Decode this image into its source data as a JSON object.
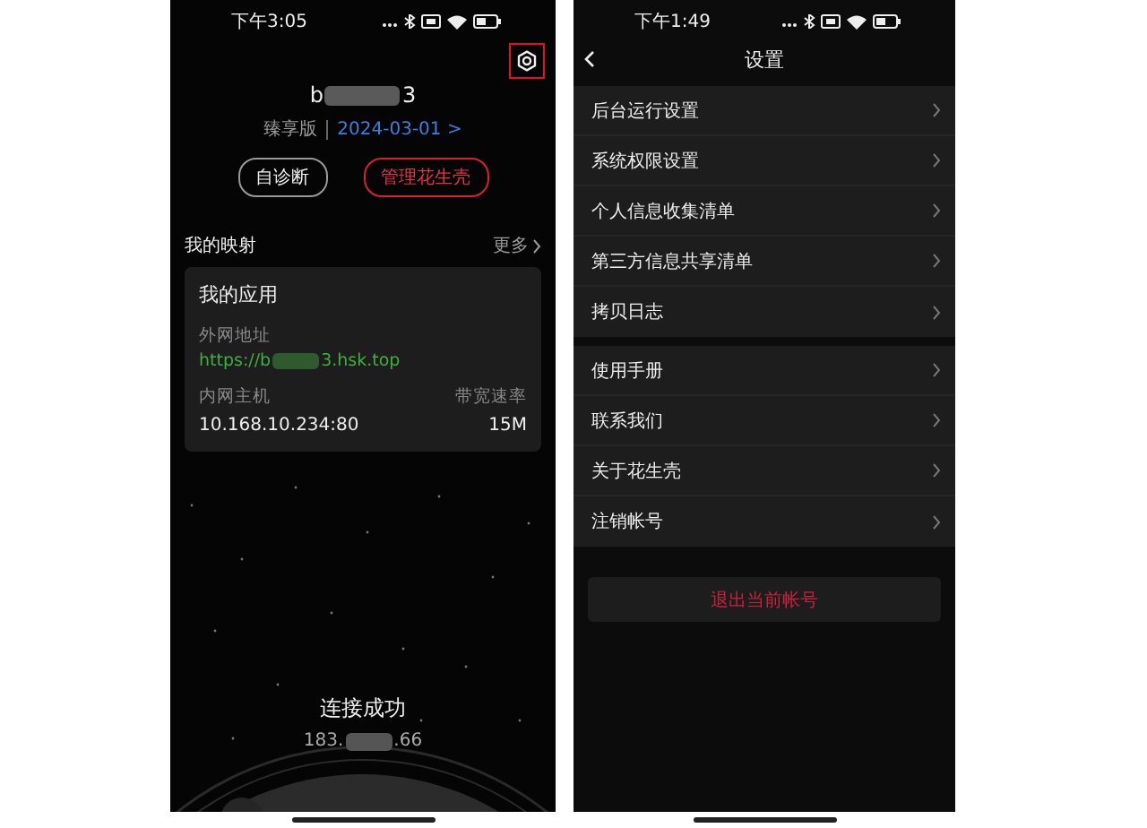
{
  "home_screen": {
    "status_bar": {
      "time": "下午3:05"
    },
    "settings_button": {
      "highlighted": true
    },
    "account": {
      "name_start": "b",
      "name_end": "3",
      "edition": "臻享版",
      "expiry": "2024-03-01 >"
    },
    "actions": [
      {
        "label": "自诊断",
        "kind": "outline"
      },
      {
        "label": "管理花生壳",
        "kind": "accent"
      }
    ],
    "mappings": {
      "title": "我的映射",
      "more": "更多",
      "card": {
        "title": "我的应用",
        "external_label": "外网地址",
        "url_start": "https://b",
        "url_end": "3.hsk.top",
        "host_label": "内网主机",
        "host": "10.168.10.234:80",
        "bandwidth_label": "带宽速率",
        "bandwidth": "15M"
      }
    },
    "connection": {
      "status": "连接成功",
      "ip_start": "183.",
      "ip_end": ".66"
    }
  },
  "settings_screen": {
    "status_bar": {
      "time": "下午1:49"
    },
    "title": "设置",
    "groups": [
      [
        "后台运行设置",
        "系统权限设置",
        "个人信息收集清单",
        "第三方信息共享清单",
        "拷贝日志"
      ],
      [
        "使用手册",
        "联系我们",
        "关于花生壳",
        "注销帐号"
      ]
    ],
    "logout": "退出当前帐号"
  }
}
